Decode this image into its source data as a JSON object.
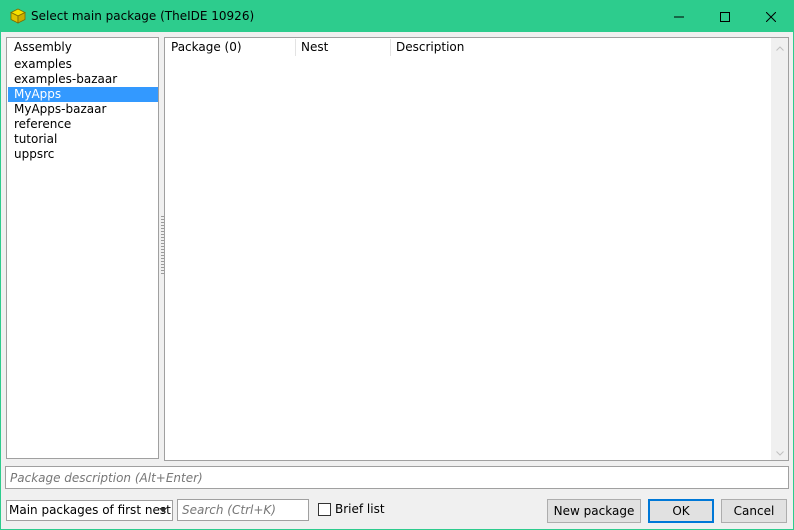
{
  "window": {
    "title": "Select main package (TheIDE 10926)",
    "accent_color": "#2dcc8d",
    "icon": "yellow-package-icon",
    "controls": [
      "minimize-icon",
      "maximize-icon",
      "close-icon"
    ]
  },
  "assembly": {
    "header": "Assembly",
    "items": [
      {
        "label": "examples",
        "selected": false
      },
      {
        "label": "examples-bazaar",
        "selected": false
      },
      {
        "label": "MyApps",
        "selected": true
      },
      {
        "label": "MyApps-bazaar",
        "selected": false
      },
      {
        "label": "reference",
        "selected": false
      },
      {
        "label": "tutorial",
        "selected": false
      },
      {
        "label": "uppsrc",
        "selected": false
      }
    ],
    "selection_color": "#3399ff"
  },
  "packages": {
    "columns": [
      "Package (0)",
      "Nest",
      "Description"
    ],
    "rows": []
  },
  "description_field": {
    "placeholder": "Package description (Alt+Enter)",
    "value": ""
  },
  "footer": {
    "filter_dropdown": "Main packages of first nest",
    "search_placeholder": "Search (Ctrl+K)",
    "brief_list_label": "Brief list",
    "brief_list_checked": false,
    "new_package_label": "New package",
    "ok_label": "OK",
    "cancel_label": "Cancel"
  }
}
